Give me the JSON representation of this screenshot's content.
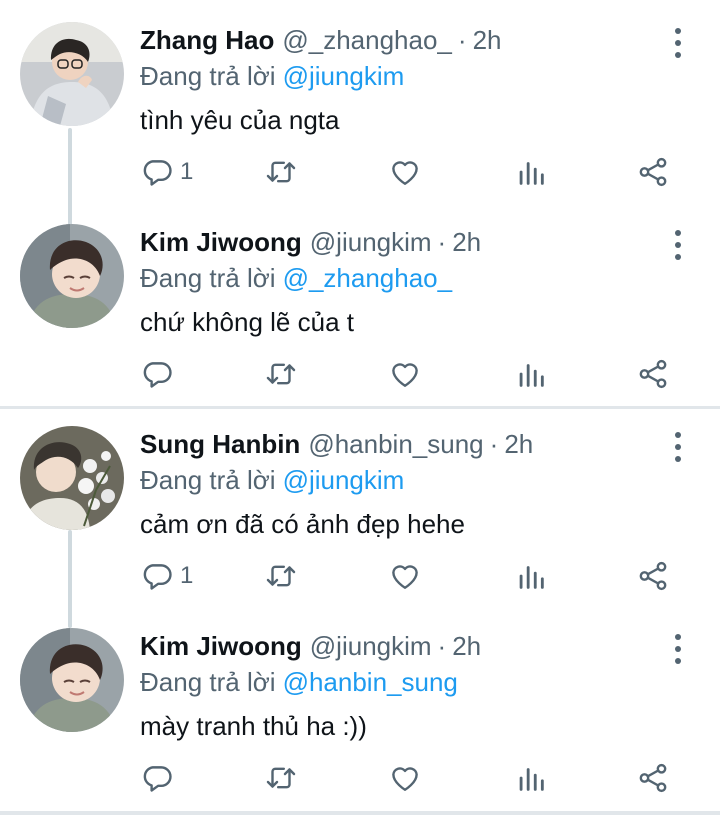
{
  "threads": [
    {
      "tweets": [
        {
          "name": "Zhang Hao",
          "handle": "@_zhanghao_",
          "separator": "·",
          "time": "2h",
          "replying_label": "Đang trả lời",
          "replying_to": "@jiungkim",
          "text": "tình yêu của ngta",
          "reply_count": "1"
        },
        {
          "name": "Kim Jiwoong",
          "handle": "@jiungkim",
          "separator": "·",
          "time": "2h",
          "replying_label": "Đang trả lời",
          "replying_to": "@_zhanghao_",
          "text": "chứ không lẽ của t",
          "reply_count": ""
        }
      ]
    },
    {
      "tweets": [
        {
          "name": "Sung Hanbin",
          "handle": "@hanbin_sung",
          "separator": "·",
          "time": "2h",
          "replying_label": "Đang trả lời",
          "replying_to": "@jiungkim",
          "text": "cảm ơn đã có ảnh đẹp hehe",
          "reply_count": "1"
        },
        {
          "name": "Kim Jiwoong",
          "handle": "@jiungkim",
          "separator": "·",
          "time": "2h",
          "replying_label": "Đang trả lời",
          "replying_to": "@hanbin_sung",
          "text": "mày tranh thủ ha :))",
          "reply_count": ""
        }
      ]
    }
  ],
  "icons": {
    "reply": "reply-icon",
    "retweet": "retweet-icon",
    "like": "heart-icon",
    "stats": "stats-icon",
    "share": "share-icon",
    "more": "more-options-icon"
  },
  "colors": {
    "text": "#0f1419",
    "secondary": "#536471",
    "link": "#1d9bf0",
    "divider": "#e1e6ea",
    "connector": "#cfd9de"
  }
}
